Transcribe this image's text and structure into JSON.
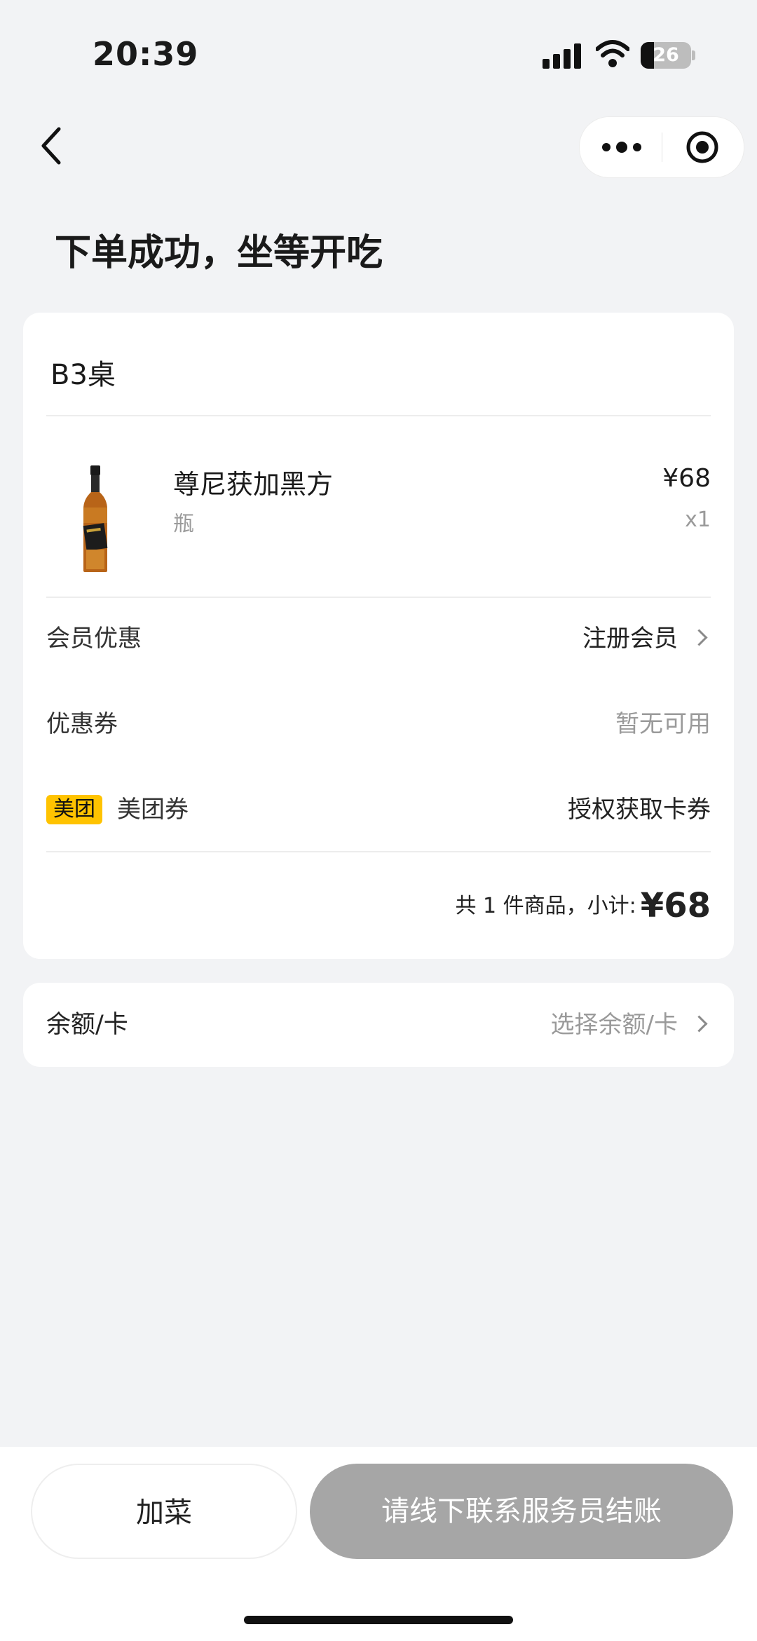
{
  "status_bar": {
    "time": "20:39",
    "battery": "26",
    "battery_level": 0.26
  },
  "nav": {
    "back_icon": "chevron-left-icon",
    "more_icon": "more-dots-icon",
    "close_icon": "target-icon"
  },
  "page": {
    "title": "下单成功，坐等开吃"
  },
  "order": {
    "table": "B3桌",
    "item": {
      "name": "尊尼获加黑方",
      "unit": "瓶",
      "price": "¥68",
      "quantity": "x1"
    },
    "member": {
      "label": "会员优惠",
      "value": "注册会员"
    },
    "coupon": {
      "label": "优惠券",
      "value": "暂无可用"
    },
    "meituan": {
      "badge": "美团",
      "label": "美团券",
      "value": "授权获取卡券"
    },
    "summary": {
      "text": "共 1 件商品，小计:",
      "total": "¥68"
    }
  },
  "balance": {
    "label": "余额/卡",
    "value": "选择余额/卡"
  },
  "actions": {
    "add_dish": "加菜",
    "checkout": "请线下联系服务员结账"
  },
  "colors": {
    "accent_badge": "#ffc300",
    "checkout_disabled": "#a6a6a6",
    "background": "#f2f3f5"
  }
}
